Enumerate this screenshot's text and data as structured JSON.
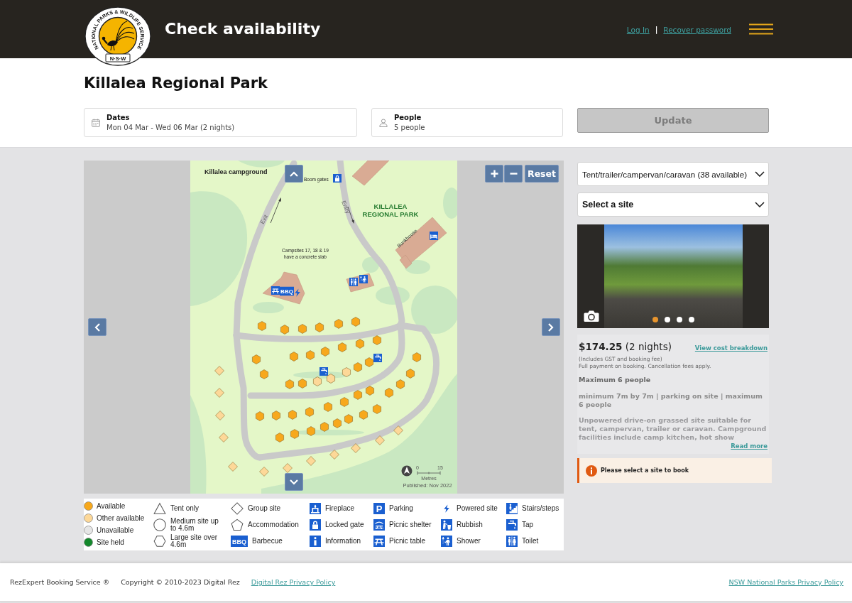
{
  "header": {
    "logo": {
      "ring_text": "NATIONAL PARKS & WILDLIFE SERVICE",
      "badge_text": "N·S·W"
    },
    "title": "Check availability",
    "links": [
      {
        "label": "Log In"
      },
      {
        "label": "Recover password"
      }
    ],
    "separator": "|"
  },
  "park_name": "Killalea Regional Park",
  "search": {
    "dates": {
      "label": "Dates",
      "value": "Mon 04 Mar - Wed 06 Mar (2 nights)"
    },
    "people": {
      "label": "People",
      "value": "5 people"
    },
    "update": {
      "label": "Update",
      "disabled": true
    }
  },
  "map": {
    "title": "Killalea campground",
    "gate_label": "Boom gates",
    "park_label": [
      "KILLALEA",
      "REGIONAL PARK"
    ],
    "exit_label": "Exit",
    "entry_label": "Entry",
    "building_label": "Bunkhouse",
    "note": [
      "Campsites 17, 18 & 19",
      "have a concrete slab"
    ],
    "scale": {
      "start": "0",
      "end": "15",
      "unit": "Metres"
    },
    "published": "Published: Nov 2022",
    "reset": "Reset",
    "facilities": [
      {
        "kind": "lock"
      },
      {
        "kind": "bed"
      },
      {
        "kind": "table"
      },
      {
        "kind": "bbq",
        "text": "BBQ"
      },
      {
        "kind": "power"
      },
      {
        "kind": "toilet"
      },
      {
        "kind": "shower"
      },
      {
        "kind": "tap"
      },
      {
        "kind": "tap"
      }
    ],
    "sites": [
      {
        "kind": "hexagon",
        "color": "#f7a81c"
      },
      {
        "kind": "hexagon",
        "color": "#f7a81c"
      },
      {
        "kind": "hexagon",
        "color": "#f7a81c"
      },
      {
        "kind": "hexagon",
        "color": "#f7a81c"
      },
      {
        "kind": "hexagon",
        "color": "#f7a81c"
      },
      {
        "kind": "hexagon",
        "color": "#f7a81c"
      },
      {
        "kind": "hexagon",
        "color": "#f7a81c"
      },
      {
        "kind": "hexagon",
        "color": "#f7a81c"
      },
      {
        "kind": "hexagon",
        "color": "#f7a81c"
      },
      {
        "kind": "hexagon",
        "color": "#f7a81c"
      },
      {
        "kind": "hexagon",
        "color": "#f7a81c"
      },
      {
        "kind": "hexagon",
        "color": "#f7a81c"
      },
      {
        "kind": "hexagon",
        "color": "#f7a81c"
      },
      {
        "kind": "hexagon",
        "color": "#f7a81c"
      },
      {
        "kind": "hexagon",
        "color": "#f7a81c"
      },
      {
        "kind": "hexagon",
        "color": "#f7a81c"
      },
      {
        "kind": "hexagon",
        "color": "#fdd898"
      },
      {
        "kind": "hexagon",
        "color": "#fdd898"
      },
      {
        "kind": "hexagon",
        "color": "#fdd898"
      },
      {
        "kind": "hexagon",
        "color": "#f7a81c"
      },
      {
        "kind": "hexagon",
        "color": "#f7a81c"
      },
      {
        "kind": "hexagon",
        "color": "#f7a81c"
      },
      {
        "kind": "hexagon",
        "color": "#f7a81c"
      },
      {
        "kind": "hexagon",
        "color": "#f7a81c"
      },
      {
        "kind": "hexagon",
        "color": "#f7a81c"
      },
      {
        "kind": "hexagon",
        "color": "#f7a81c"
      },
      {
        "kind": "hexagon",
        "color": "#f7a81c"
      },
      {
        "kind": "hexagon",
        "color": "#f7a81c"
      },
      {
        "kind": "hexagon",
        "color": "#f7a81c"
      },
      {
        "kind": "hexagon",
        "color": "#f7a81c"
      },
      {
        "kind": "hexagon",
        "color": "#f7a81c"
      },
      {
        "kind": "hexagon",
        "color": "#f7a81c"
      },
      {
        "kind": "hexagon",
        "color": "#f7a81c"
      },
      {
        "kind": "hexagon",
        "color": "#f7a81c"
      },
      {
        "kind": "hexagon",
        "color": "#f7a81c"
      },
      {
        "kind": "hexagon",
        "color": "#f7a81c"
      },
      {
        "kind": "hexagon",
        "color": "#f7a81c"
      },
      {
        "kind": "hexagon",
        "color": "#f7a81c"
      },
      {
        "kind": "hexagon",
        "color": "#f7a81c"
      },
      {
        "kind": "hexagon",
        "color": "#f7a81c"
      },
      {
        "kind": "hexagon",
        "color": "#f7a81c"
      },
      {
        "kind": "diamond",
        "color": "#fdd898"
      },
      {
        "kind": "diamond",
        "color": "#fdd898"
      },
      {
        "kind": "diamond",
        "color": "#fdd898"
      },
      {
        "kind": "diamond",
        "color": "#fdd898"
      },
      {
        "kind": "diamond",
        "color": "#fdd898"
      },
      {
        "kind": "diamond",
        "color": "#fdd898"
      },
      {
        "kind": "diamond",
        "color": "#fdd898"
      },
      {
        "kind": "diamond",
        "color": "#fdd898"
      },
      {
        "kind": "diamond",
        "color": "#fdd898"
      },
      {
        "kind": "diamond",
        "color": "#fdd898"
      },
      {
        "kind": "diamond",
        "color": "#fdd898"
      },
      {
        "kind": "diamond",
        "color": "#fdd898"
      }
    ]
  },
  "legend": [
    [
      {
        "kind": "status",
        "color": "#f7a81c",
        "label": "Available"
      },
      {
        "kind": "status",
        "color": "#fdd898",
        "label": "Other available"
      },
      {
        "kind": "status",
        "color": "#e6e6e6",
        "label": "Unavailable"
      },
      {
        "kind": "status",
        "color": "#14882c",
        "label": "Site held"
      }
    ],
    [
      {
        "kind": "triangle",
        "label": "Tent only"
      },
      {
        "kind": "circle",
        "label": "Medium site up to 4.6m"
      },
      {
        "kind": "hexagon",
        "label": "Large site over 4.6m"
      }
    ],
    [
      {
        "kind": "diamond",
        "label": "Group site"
      },
      {
        "kind": "pentagon",
        "label": "Accommodation"
      },
      {
        "kind": "bbq",
        "text": "BBQ",
        "label": "Barbecue"
      }
    ],
    [
      {
        "kind": "fireplace",
        "label": "Fireplace"
      },
      {
        "kind": "lock",
        "label": "Locked gate"
      },
      {
        "kind": "info",
        "label": "Information"
      }
    ],
    [
      {
        "kind": "parking",
        "text": "P",
        "label": "Parking"
      },
      {
        "kind": "shelter",
        "label": "Picnic shelter"
      },
      {
        "kind": "table",
        "label": "Picnic table"
      }
    ],
    [
      {
        "kind": "power",
        "label": "Powered site"
      },
      {
        "kind": "rubbish",
        "label": "Rubbish"
      },
      {
        "kind": "shower",
        "label": "Shower"
      }
    ],
    [
      {
        "kind": "stairs",
        "label": "Stairs/steps"
      },
      {
        "kind": "tap",
        "label": "Tap"
      },
      {
        "kind": "toilet",
        "label": "Toilet"
      }
    ]
  ],
  "site_panel": {
    "site_type": "Tent/trailer/campervan/caravan (38 available)",
    "site_select": "Select a site",
    "photo_dots": [
      {
        "selected": true
      },
      {
        "selected": false
      },
      {
        "selected": false
      },
      {
        "selected": false
      }
    ],
    "price_line": "**$174.25** (2 nights)",
    "cost_link": "View cost breakdown",
    "fee_note": "(Includes GST and booking fee)",
    "payment_note": "Full payment on booking. Cancellation fees apply.",
    "capacity": "Maximum 6 people",
    "features": "minimum 7m by 7m | parking on site | maximum 6 people",
    "description": "Unpowered drive-on grassed site suitable for tent, campervan, trailer or caravan. Campground facilities include camp kitchen, hot show",
    "read_more": "Read more",
    "alert": "Please select a site to book"
  },
  "footer": {
    "items": [
      {
        "kind": "text",
        "text": "RezExpert Booking Service ®"
      },
      {
        "kind": "text",
        "text": "Copyright © 2010-2023 Digital Rez"
      },
      {
        "kind": "link",
        "text": "Digital Rez Privacy Policy"
      }
    ],
    "right_link": "NSW National Parks Privacy Policy"
  }
}
